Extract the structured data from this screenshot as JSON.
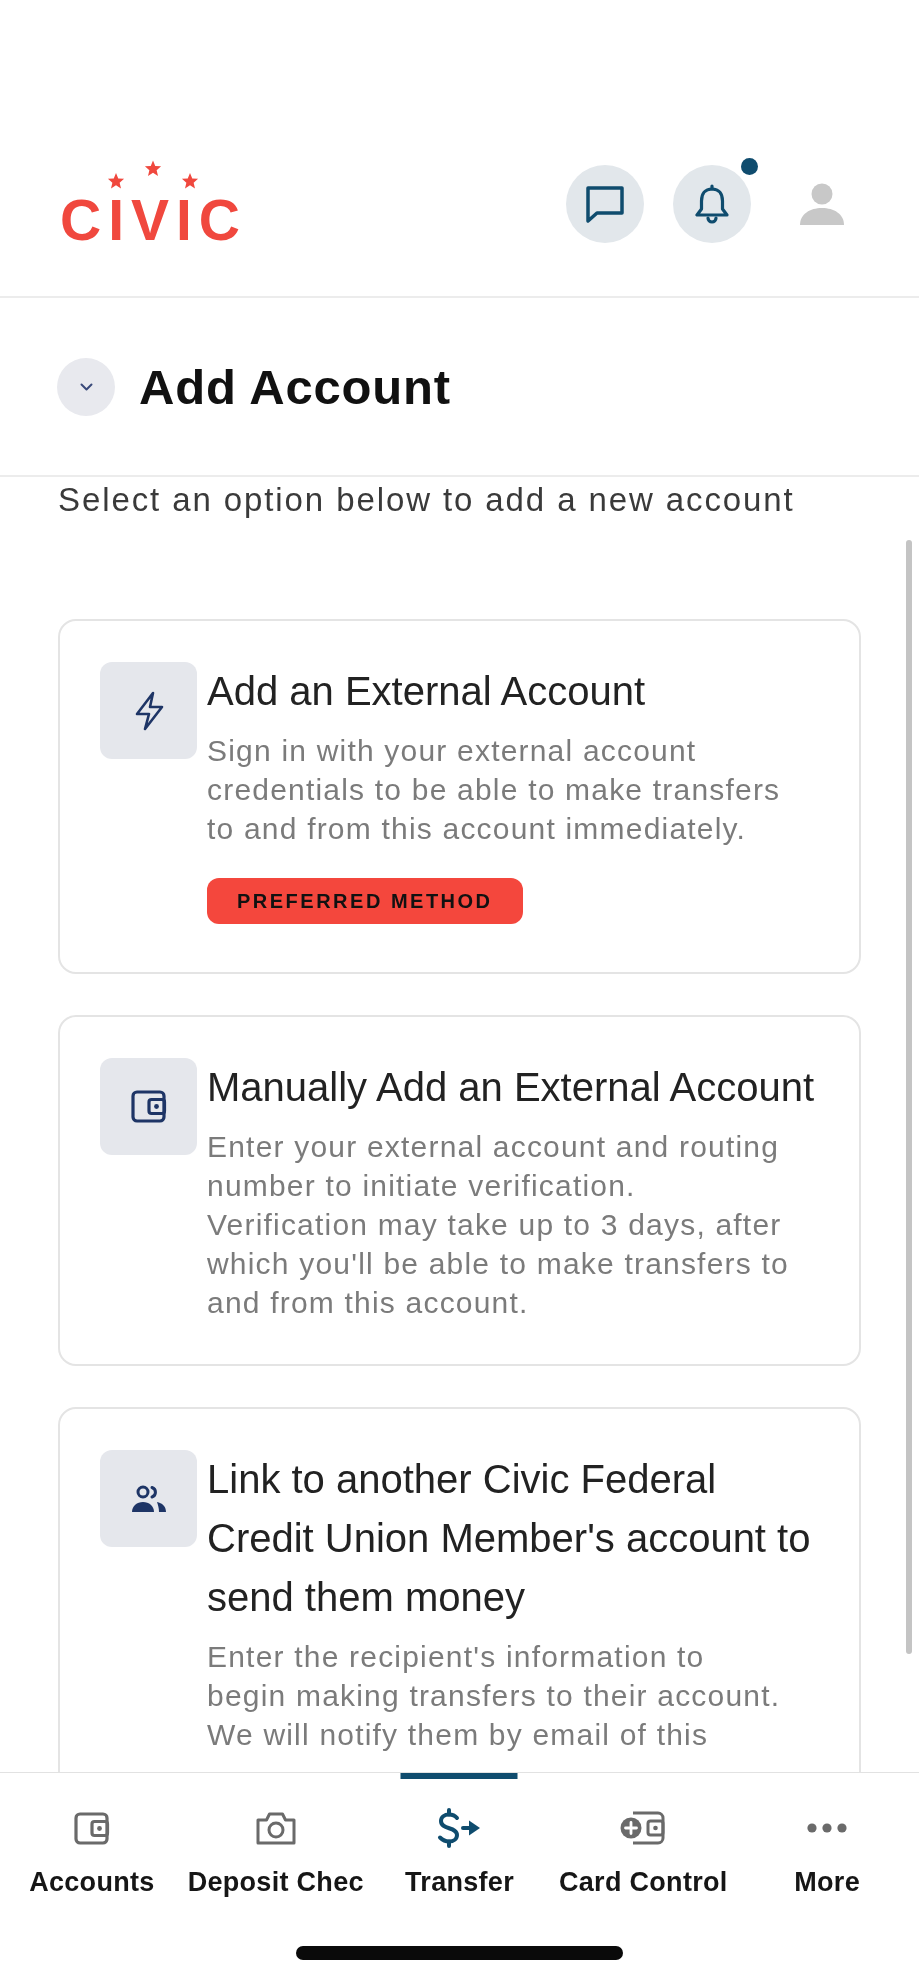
{
  "header": {
    "logo": "CIVIC",
    "notifications_unread": true
  },
  "page": {
    "title": "Add Account",
    "subtitle": "Select an option below to add a new account"
  },
  "options": [
    {
      "title": "Add an External Account",
      "description": "Sign in with your external account\ncredentials to be able to make transfers\nto and from this account immediately.",
      "badge": "PREFERRED METHOD"
    },
    {
      "title": "Manually Add an External Account",
      "description": "Enter your external account and routing\nnumber to initiate verification.\nVerification may take up to 3 days, after\nwhich you'll be able to make transfers to\nand from this account."
    },
    {
      "title": "Link to another Civic Federal\nCredit Union Member's account to\nsend them money",
      "description": "Enter the recipient's information to\nbegin making transfers to their account.\nWe will notify them by email of this"
    }
  ],
  "nav": [
    {
      "label": "Accounts",
      "selected": false
    },
    {
      "label": "Deposit Chec",
      "selected": false
    },
    {
      "label": "Transfer",
      "selected": true
    },
    {
      "label": "Card Control",
      "selected": false
    },
    {
      "label": "More",
      "selected": false
    }
  ]
}
